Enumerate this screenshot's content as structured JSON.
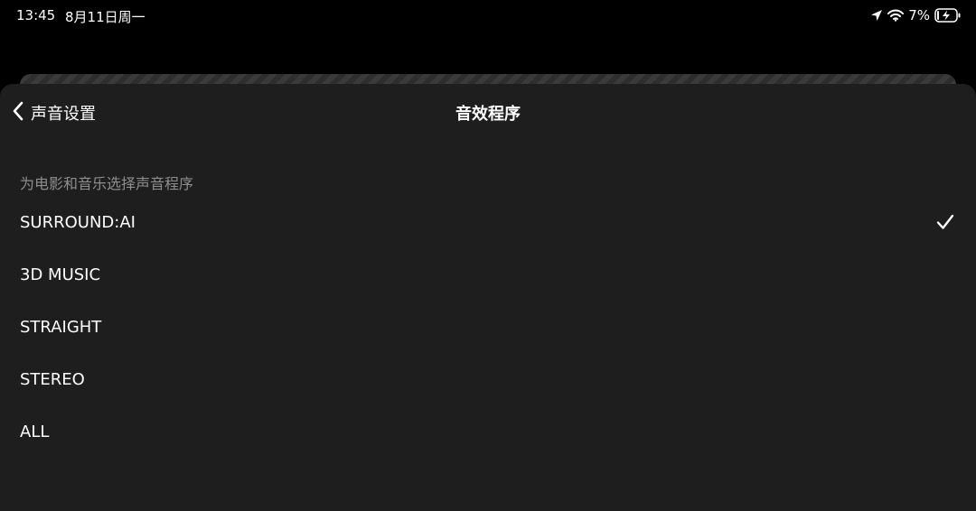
{
  "status_bar": {
    "time": "13:45",
    "date": "8月11日周一",
    "battery_percent": "7%",
    "icons": [
      "location-arrow-icon",
      "wifi-icon",
      "battery-charging-icon"
    ]
  },
  "header": {
    "back_label": "声音设置",
    "title": "音效程序"
  },
  "section": {
    "header": "为电影和音乐选择声音程序"
  },
  "options": [
    {
      "label": "SURROUND:AI",
      "selected": true
    },
    {
      "label": "3D MUSIC",
      "selected": false
    },
    {
      "label": "STRAIGHT",
      "selected": false
    },
    {
      "label": "STEREO",
      "selected": false
    },
    {
      "label": "ALL",
      "selected": false
    }
  ],
  "colors": {
    "background": "#000000",
    "sheet": "#1e1e1e",
    "text": "#ffffff",
    "secondary_text": "#8e8e8e"
  }
}
